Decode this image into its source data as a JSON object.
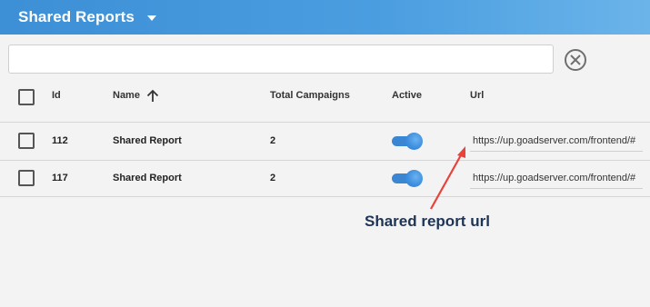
{
  "header": {
    "title": "Shared Reports"
  },
  "search": {
    "value": "",
    "placeholder": ""
  },
  "table": {
    "columns": {
      "id": "Id",
      "name": "Name",
      "campaigns": "Total Campaigns",
      "active": "Active",
      "url": "Url"
    },
    "sort": {
      "column": "Name",
      "direction": "ascending"
    },
    "rows": [
      {
        "id": "112",
        "name": "Shared Report",
        "campaigns": "2",
        "active": true,
        "url": "https://up.goadserver.com/frontend/#"
      },
      {
        "id": "117",
        "name": "Shared Report",
        "campaigns": "2",
        "active": true,
        "url": "https://up.goadserver.com/frontend/#"
      }
    ]
  },
  "annotation": {
    "text": "Shared report url",
    "color": "#1e3456",
    "arrow_color": "#e8423a"
  },
  "colors": {
    "header": "#4b9ee0",
    "toggle": "#3b86d2"
  }
}
